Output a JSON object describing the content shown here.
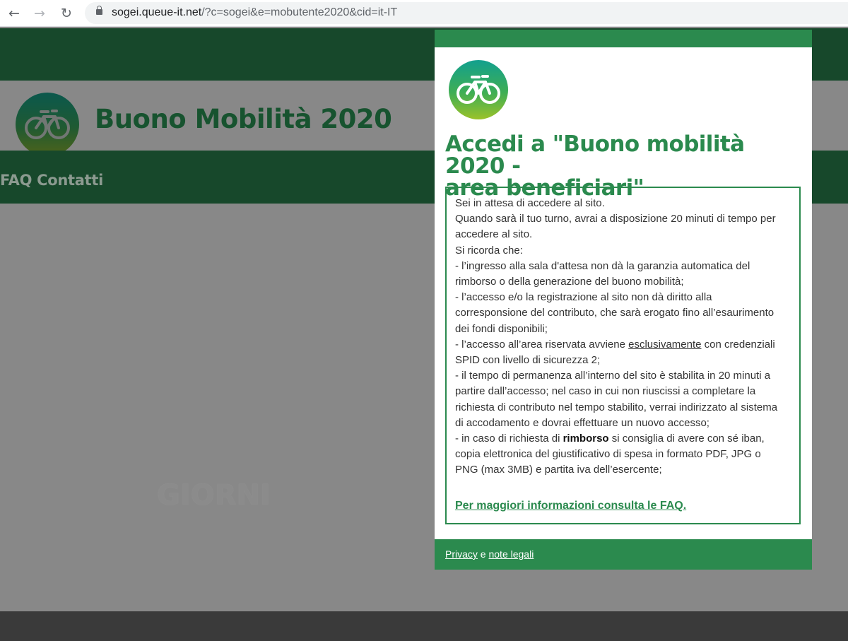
{
  "browser": {
    "url_host": "sogei.queue-it.net",
    "url_rest": "/?c=sogei&e=mobutente2020&cid=it-IT"
  },
  "background_page": {
    "site_title": "Buono Mobilità 2020",
    "menu_text": "FAQ Contatti",
    "ghost_text": "GIORNI"
  },
  "modal": {
    "title_line1": "Accedi a \"Buono mobilità 2020 -",
    "title_line2": "area beneficiari\"",
    "info": {
      "l1": "Sei in attesa di accedere al sito.",
      "l2": "Quando sarà il tuo turno, avrai a disposizione 20 minuti di tempo per",
      "l3": "accedere al sito.",
      "l4": "Si ricorda che:",
      "l5": "- l’ingresso alla sala d'attesa non dà la garanzia automatica del",
      "l6": "rimborso o della generazione del buono mobilità;",
      "l7": "- l’accesso e/o la registrazione al sito non dà diritto alla",
      "l8": "corresponsione del contributo, che sarà erogato fino all’esaurimento",
      "l9": "dei fondi disponibili;",
      "l10_a": "- l’accesso all’area riservata avviene ",
      "l10_b": "esclusivamente",
      "l10_c": " con credenziali",
      "l11": "SPID con livello di sicurezza 2;",
      "l12": "- il tempo di permanenza all’interno del sito è stabilita in 20 minuti a",
      "l13": "partire dall’accesso; nel caso in cui non riuscissi a completare la",
      "l14": "richiesta di contributo nel tempo stabilito, verrai indirizzato al sistema",
      "l15": "di accodamento e dovrai effettuare un nuovo accesso;",
      "l16_a": "- in caso di richiesta di ",
      "l16_b": "rimborso",
      "l16_c": " si consiglia di avere con sé iban,",
      "l17": "copia elettronica del giustificativo di spesa in formato PDF, JPG o",
      "l18": "PNG (max 3MB) e partita iva dell’esercente;"
    },
    "faq_link": "Per maggiori informazioni consulta le FAQ.",
    "footer": {
      "privacy": "Privacy",
      "and": " e ",
      "legal": "note legali"
    }
  },
  "colors": {
    "brand_green": "#2b8a4e",
    "dark_green": "#17482b",
    "overlay_gray": "#888888"
  },
  "icons": [
    "back-arrow-icon",
    "forward-arrow-icon",
    "reload-icon",
    "lock-icon",
    "bicycle-icon"
  ]
}
